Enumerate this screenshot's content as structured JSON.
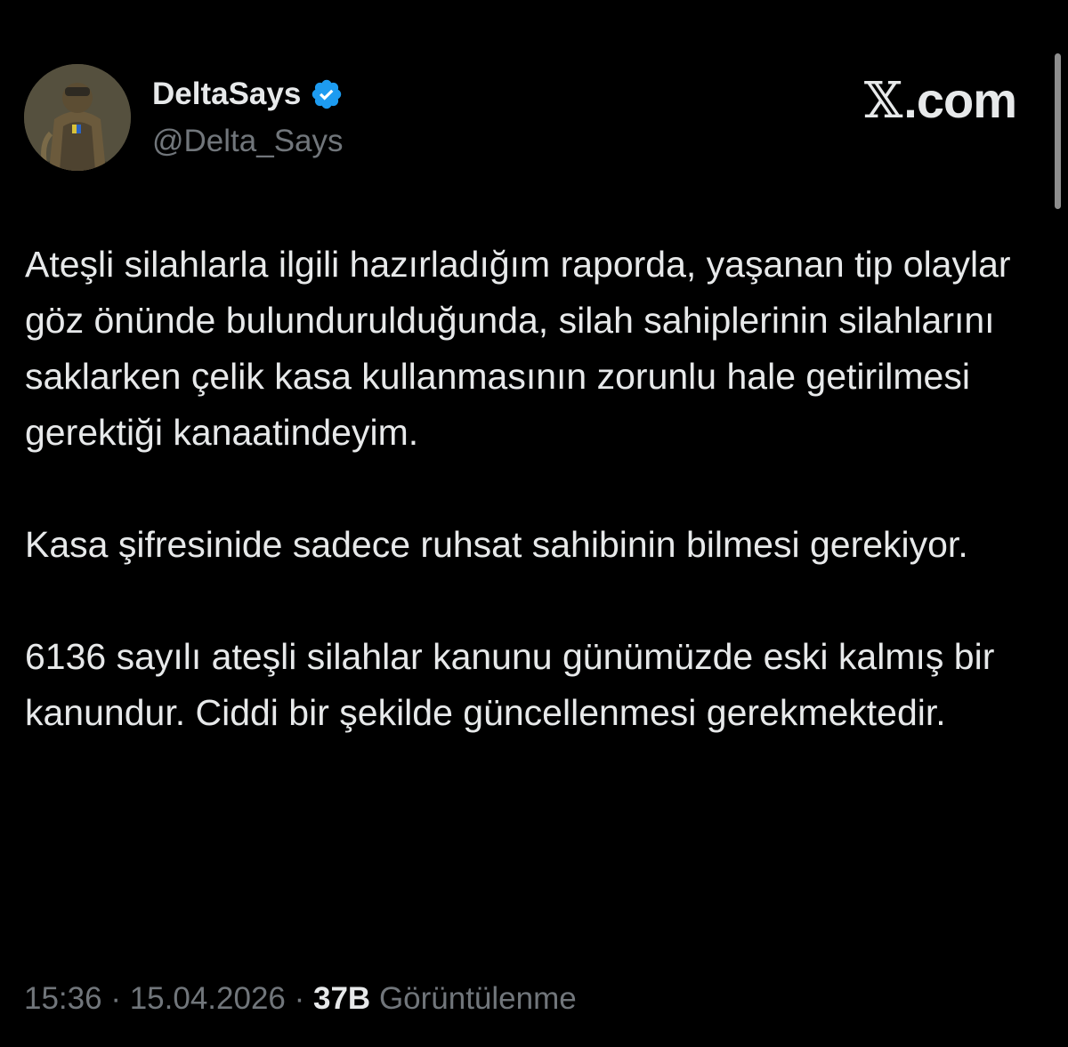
{
  "author": {
    "display_name": "DeltaSays",
    "handle": "@Delta_Says",
    "verified": true,
    "verified_color": "#1d9bf0"
  },
  "brand": {
    "glyph": "𝕏",
    "domain": ".com"
  },
  "tweet": {
    "paragraphs": [
      "Ateşli silahlarla ilgili hazırladığım raporda, yaşanan tip olaylar göz önünde bulundurulduğunda, silah sahiplerinin silahlarını saklarken çelik kasa kullanmasının zorunlu hale getirilmesi gerektiği kanaatindeyim.",
      "Kasa şifresinide sadece ruhsat sahibinin bilmesi gerekiyor.",
      "6136 sayılı ateşli silahlar kanunu günümüzde eski kalmış bir kanundur. Ciddi bir şekilde güncellenmesi gerekmektedir."
    ]
  },
  "meta": {
    "time": "15:36",
    "separator": " · ",
    "date": "15.04.2026",
    "views_count": "37B",
    "views_label": "Görüntülenme"
  }
}
